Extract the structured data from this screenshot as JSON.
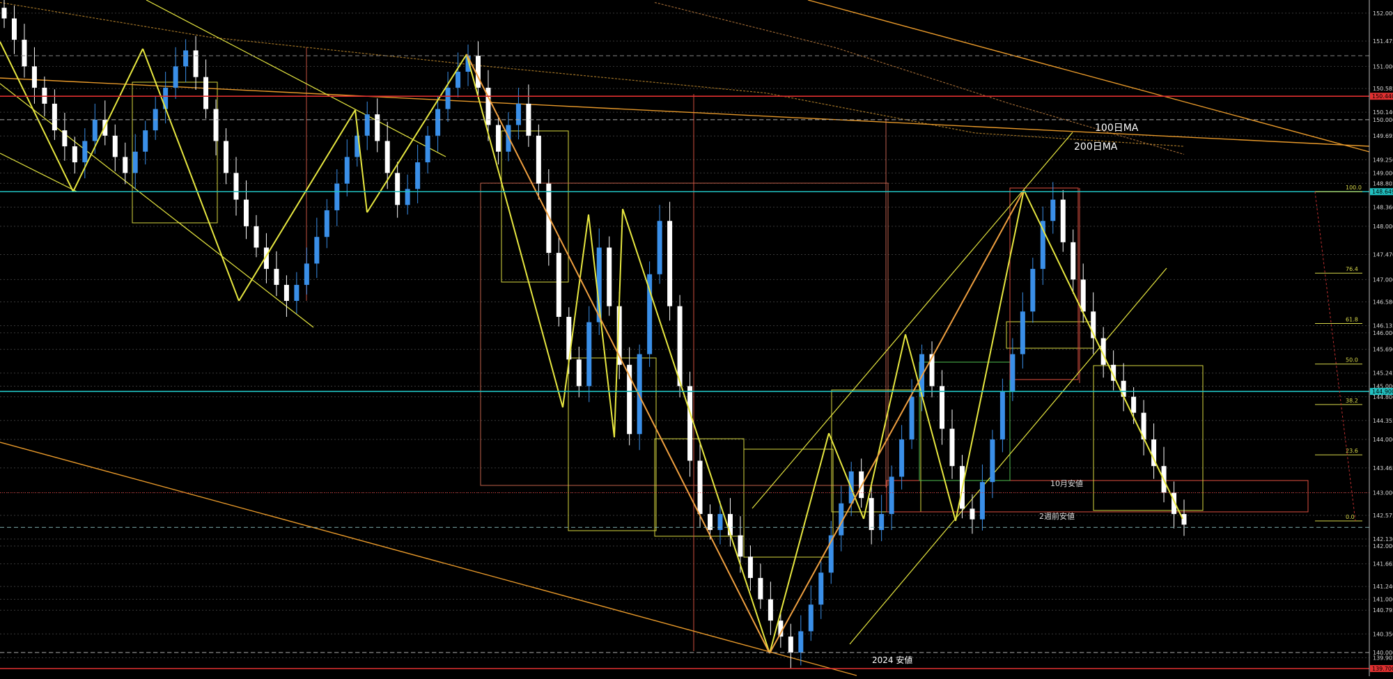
{
  "chart_data": {
    "type": "candlestick",
    "background": "#000000",
    "grid": "dashed horizontal",
    "y_axis": {
      "position": "right",
      "range": [
        139.7,
        152.05
      ],
      "ticks": [
        "152.000",
        "151.475",
        "151.000",
        "150.585",
        "150.140",
        "150.000",
        "149.695",
        "149.250",
        "149.000",
        "148.805",
        "148.360",
        "148.000",
        "147.470",
        "147.000",
        "146.580",
        "146.135",
        "146.000",
        "145.690",
        "145.245",
        "145.000",
        "144.800",
        "144.355",
        "144.000",
        "143.465",
        "143.000",
        "142.575",
        "142.130",
        "142.000",
        "141.665",
        "141.240",
        "141.000",
        "140.795",
        "140.350",
        "140.000",
        "139.905"
      ],
      "highlighted": [
        {
          "label": "150.440",
          "color": "#e03030"
        },
        {
          "label": "148.649",
          "color": "#20c0c0"
        },
        {
          "label": "144.900",
          "color": "#20c0c0"
        },
        {
          "label": "139.700",
          "color": "#e03030"
        }
      ]
    },
    "horizontal_levels": [
      {
        "price": 150.44,
        "color": "#e03030",
        "style": "solid"
      },
      {
        "price": 148.649,
        "color": "#20c0c0",
        "style": "solid"
      },
      {
        "price": 144.9,
        "color": "#20c0c0",
        "style": "solid"
      },
      {
        "price": 139.7,
        "color": "#e03030",
        "style": "solid"
      },
      {
        "price": 143.0,
        "color": "#e03030",
        "style": "dotted"
      },
      {
        "price": 142.35,
        "color": "#80b0b0",
        "style": "dashed"
      },
      {
        "price": 151.2,
        "color": "#888888",
        "style": "dashed"
      },
      {
        "price": 150.0,
        "color": "#aaaaaa",
        "style": "dashed"
      },
      {
        "price": 140.0,
        "color": "#aaaaaa",
        "style": "dashed"
      }
    ],
    "fibonacci": {
      "levels": [
        "100.0",
        "76.4",
        "61.8",
        "50.0",
        "38.2",
        "23.6",
        "0.0"
      ],
      "prices": [
        148.649,
        147.12,
        146.175,
        145.415,
        144.655,
        143.71,
        142.47
      ],
      "color": "#d9d94a"
    },
    "series": [
      {
        "name": "100日MA",
        "color": "#c89030",
        "points": [
          [
            0,
            152.2
          ],
          [
            300,
            151.55
          ],
          [
            700,
            151.0
          ],
          [
            1100,
            150.5
          ],
          [
            1400,
            149.75
          ],
          [
            1700,
            149.5
          ]
        ]
      },
      {
        "name": "200日MA",
        "color": "#c08040",
        "points": [
          [
            940,
            152.2
          ],
          [
            1200,
            151.35
          ],
          [
            1450,
            150.3
          ],
          [
            1700,
            149.35
          ]
        ]
      }
    ],
    "candles_close": [
      151.9,
      151.5,
      151.0,
      150.6,
      150.3,
      149.8,
      149.5,
      149.2,
      149.6,
      150.0,
      149.7,
      149.3,
      149.0,
      149.4,
      149.8,
      150.2,
      150.6,
      151.0,
      151.3,
      150.8,
      150.2,
      149.6,
      149.0,
      148.5,
      148.0,
      147.6,
      147.2,
      146.9,
      146.6,
      146.9,
      147.3,
      147.8,
      148.3,
      148.8,
      149.3,
      149.7,
      150.1,
      149.6,
      149.0,
      148.4,
      148.7,
      149.2,
      149.7,
      150.2,
      150.6,
      150.9,
      151.2,
      150.6,
      149.9,
      149.4,
      149.9,
      150.3,
      149.7,
      148.8,
      147.5,
      146.3,
      145.5,
      145.0,
      146.2,
      147.6,
      146.5,
      145.4,
      144.1,
      145.6,
      147.1,
      148.1,
      146.5,
      145.0,
      143.6,
      142.6,
      142.3,
      142.6,
      142.2,
      141.8,
      141.4,
      141.0,
      140.6,
      140.3,
      140.0,
      140.4,
      140.9,
      141.5,
      142.2,
      142.8,
      143.4,
      142.9,
      142.3,
      142.6,
      143.3,
      144.0,
      144.8,
      145.6,
      145.0,
      144.2,
      143.5,
      142.7,
      142.5,
      143.2,
      144.0,
      144.9,
      145.6,
      146.4,
      147.2,
      148.1,
      148.5,
      147.7,
      147.0,
      146.4,
      145.9,
      145.4,
      145.1,
      144.8,
      144.5,
      144.0,
      143.5,
      143.0,
      142.6,
      142.4
    ],
    "annotations": [
      {
        "text": "100日MA"
      },
      {
        "text": "200日MA"
      },
      {
        "text": "10月安値"
      },
      {
        "text": "2週前安値"
      },
      {
        "text": "2024 安値"
      }
    ]
  }
}
